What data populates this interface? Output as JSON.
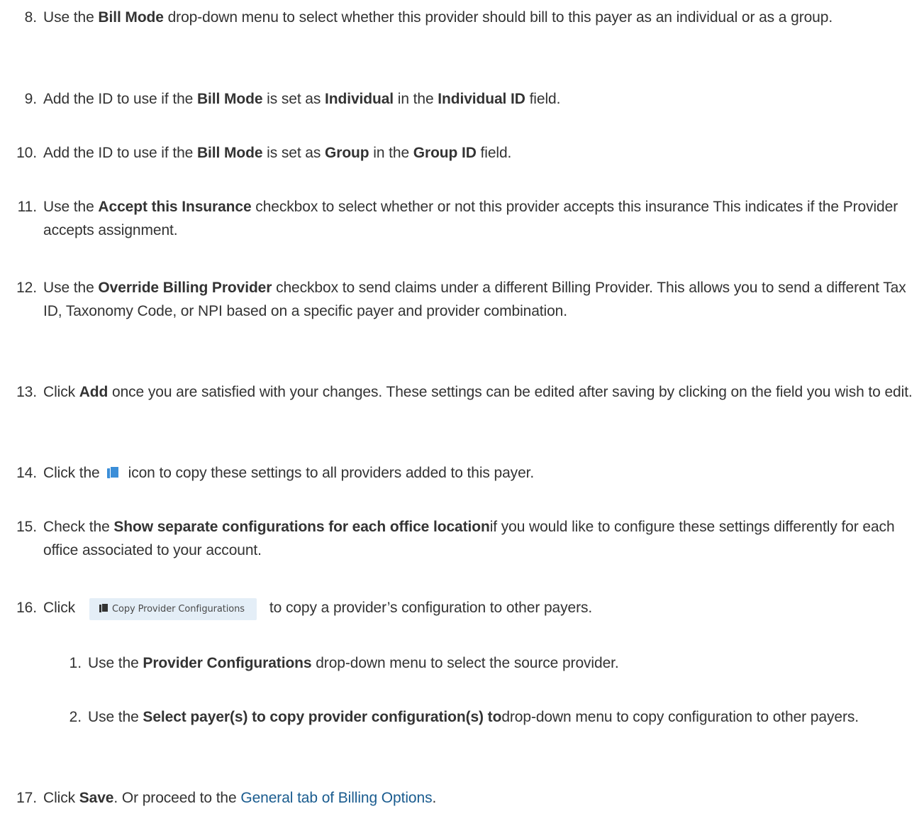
{
  "steps": {
    "s8": {
      "num": "8.",
      "pre": "Use the ",
      "b1": "Bill Mode",
      "post": " drop-down menu to select whether this provider should bill to this payer as an individual or as a group."
    },
    "s9": {
      "num": "9.",
      "pre": "Add the ID to use if the ",
      "b1": "Bill Mode",
      "mid1": " is set as ",
      "b2": "Individual",
      "mid2": " in the ",
      "b3": "Individual ID",
      "post": " field."
    },
    "s10": {
      "num": "10.",
      "pre": "Add the ID to use if the ",
      "b1": "Bill Mode",
      "mid1": " is set as ",
      "b2": "Group",
      "mid2": " in the ",
      "b3": "Group ID",
      "post": " field."
    },
    "s11": {
      "num": "11.",
      "pre": "Use the ",
      "b1": "Accept this Insurance",
      "post": " checkbox to select whether or not this provider accepts this insurance This indicates if the Provider accepts assignment."
    },
    "s12": {
      "num": "12.",
      "pre": "Use the ",
      "b1": "Override Billing Provider",
      "post": " checkbox to send claims under a different Billing Provider. This allows you to send a different Tax ID, Taxonomy Code, or NPI based on a specific payer and provider combination."
    },
    "s13": {
      "num": "13.",
      "pre": "Click ",
      "b1": "Add",
      "post": " once you are satisfied with your changes. These settings can be edited after saving by clicking on the field you wish to edit."
    },
    "s14": {
      "num": "14.",
      "pre": "Click the",
      "post": "icon to copy these settings to all providers added to this payer."
    },
    "s15": {
      "num": "15.",
      "pre": "Check the ",
      "b1": "Show separate configurations for each office location",
      "post": "if you would like to configure these settings differently for each office associated to your account."
    },
    "s16": {
      "num": "16.",
      "pre": "Click",
      "button_label": "Copy Provider Configurations",
      "post": "to copy a provider’s configuration to other payers."
    },
    "s16_1": {
      "num": "1.",
      "pre": "Use the ",
      "b1": "Provider Configurations",
      "post": " drop-down menu to select the source provider."
    },
    "s16_2": {
      "num": "2.",
      "pre": "Use the ",
      "b1": "Select payer(s) to copy provider configuration(s) to",
      "post": "drop-down menu to copy configuration to other payers."
    },
    "s17": {
      "num": "17.",
      "pre": "Click ",
      "b1": "Save",
      "mid1": ". Or proceed to the ",
      "link": "General tab of Billing Options",
      "post": "."
    }
  },
  "icons": {
    "copy": "copy-documents-icon"
  },
  "colors": {
    "text": "#333333",
    "link": "#1a5c8f",
    "icon_accent": "#3b8ed8",
    "button_bg": "#e4eef7"
  }
}
